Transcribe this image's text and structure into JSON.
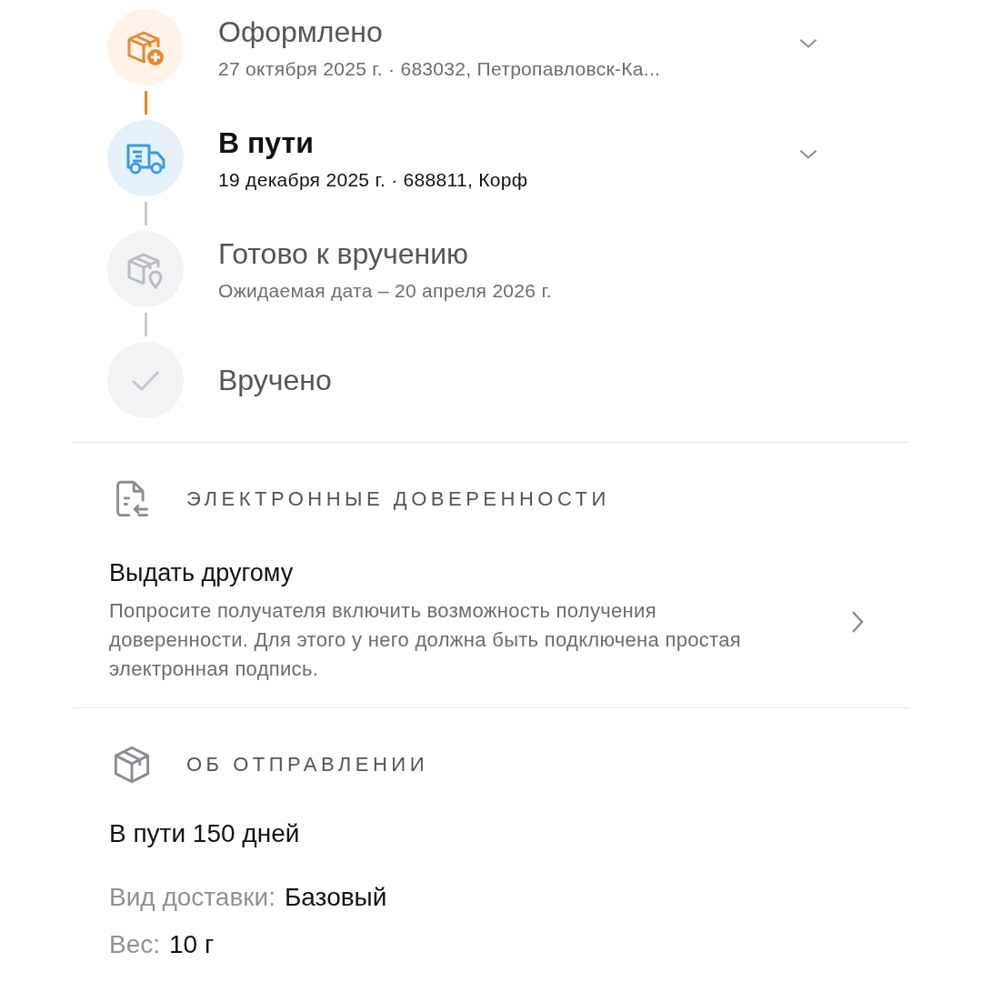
{
  "steps": [
    {
      "kind": "created",
      "current": false,
      "title": "Оформлено",
      "subtitle": "27 октября 2025 г. · 683032, Петропавловск-Ка...",
      "chevron": true
    },
    {
      "kind": "transit",
      "current": true,
      "title": "В пути",
      "subtitle": "19 декабря 2025 г. · 688811, Корф",
      "chevron": true
    },
    {
      "kind": "ready",
      "current": false,
      "title": "Готово к вручению",
      "subtitle": "Ожидаемая дата – 20 апреля 2026 г.",
      "chevron": false
    },
    {
      "kind": "delivered",
      "current": false,
      "title": "Вручено",
      "chevron": false
    }
  ],
  "proxy": {
    "header": "ЭЛЕКТРОННЫЕ ДОВЕРЕННОСТИ",
    "title": "Выдать другому",
    "description": "Попросите получателя включить возможность получения доверенности. Для этого у него должна быть подключена простая электронная подпись."
  },
  "shipment": {
    "header": "ОБ ОТПРАВЛЕНИИ",
    "summary": "В пути 150 дней",
    "fields": [
      {
        "label": "Вид доставки:",
        "value": "Базовый"
      },
      {
        "label": "Вес:",
        "value": "10 г"
      }
    ]
  }
}
